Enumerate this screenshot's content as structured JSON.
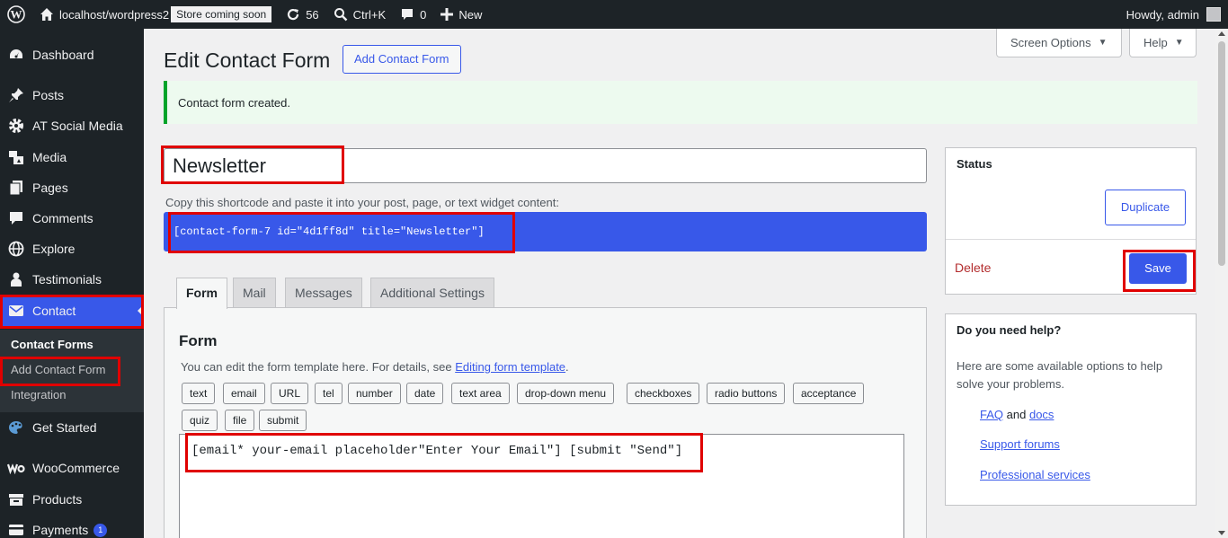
{
  "adminbar": {
    "site": "localhost/wordpress2",
    "store_badge": "Store coming soon",
    "updates": "56",
    "search": "Ctrl+K",
    "comments": "0",
    "new": "New",
    "greeting": "Howdy, admin"
  },
  "sidebar": {
    "items": [
      {
        "label": "Dashboard",
        "icon": "dashboard-icon"
      },
      {
        "label": "Posts",
        "icon": "pin-icon"
      },
      {
        "label": "AT Social Media",
        "icon": "gear-icon"
      },
      {
        "label": "Media",
        "icon": "media-icon"
      },
      {
        "label": "Pages",
        "icon": "pages-icon"
      },
      {
        "label": "Comments",
        "icon": "comment-icon"
      },
      {
        "label": "Explore",
        "icon": "globe-icon"
      },
      {
        "label": "Testimonials",
        "icon": "person-icon"
      },
      {
        "label": "Contact",
        "icon": "mail-icon"
      },
      {
        "label": "Get Started",
        "icon": "palette-icon"
      },
      {
        "label": "WooCommerce",
        "icon": "woo-icon"
      },
      {
        "label": "Products",
        "icon": "archive-icon"
      },
      {
        "label": "Payments",
        "icon": "card-icon",
        "badge": "1"
      }
    ],
    "submenu": [
      "Contact Forms",
      "Add Contact Form",
      "Integration"
    ]
  },
  "header": {
    "title": "Edit Contact Form",
    "add_button": "Add Contact Form",
    "screen_options": "Screen Options",
    "help": "Help"
  },
  "notice": "Contact form created.",
  "form": {
    "title": "Newsletter",
    "shortcode_label": "Copy this shortcode and paste it into your post, page, or text widget content:",
    "shortcode": "[contact-form-7 id=\"4d1ff8d\" title=\"Newsletter\"]",
    "tabs": [
      "Form",
      "Mail",
      "Messages",
      "Additional Settings"
    ],
    "panel_title": "Form",
    "panel_desc_prefix": "You can edit the form template here. For details, see ",
    "panel_desc_link": "Editing form template",
    "panel_desc_suffix": ".",
    "tags_row1": [
      "text",
      "email",
      "URL",
      "tel",
      "number",
      "date",
      "text area",
      "drop-down menu",
      "checkboxes",
      "radio buttons",
      "acceptance"
    ],
    "tags_row2": [
      "quiz",
      "file",
      "submit"
    ],
    "template": "[email* your-email placeholder\"Enter Your Email\"] [submit \"Send\"]"
  },
  "status_box": {
    "title": "Status",
    "duplicate": "Duplicate",
    "delete": "Delete",
    "save": "Save"
  },
  "help_box": {
    "title": "Do you need help?",
    "text": "Here are some available options to help solve your problems.",
    "faq": "FAQ",
    "and": "and",
    "docs": "docs",
    "support": "Support forums",
    "professional": "Professional services"
  },
  "colors": {
    "accent": "#3858e9",
    "admin_bar": "#1d2327",
    "highlight": "#e00000",
    "notice_border": "#00a32a",
    "delete": "#b32d2e"
  }
}
